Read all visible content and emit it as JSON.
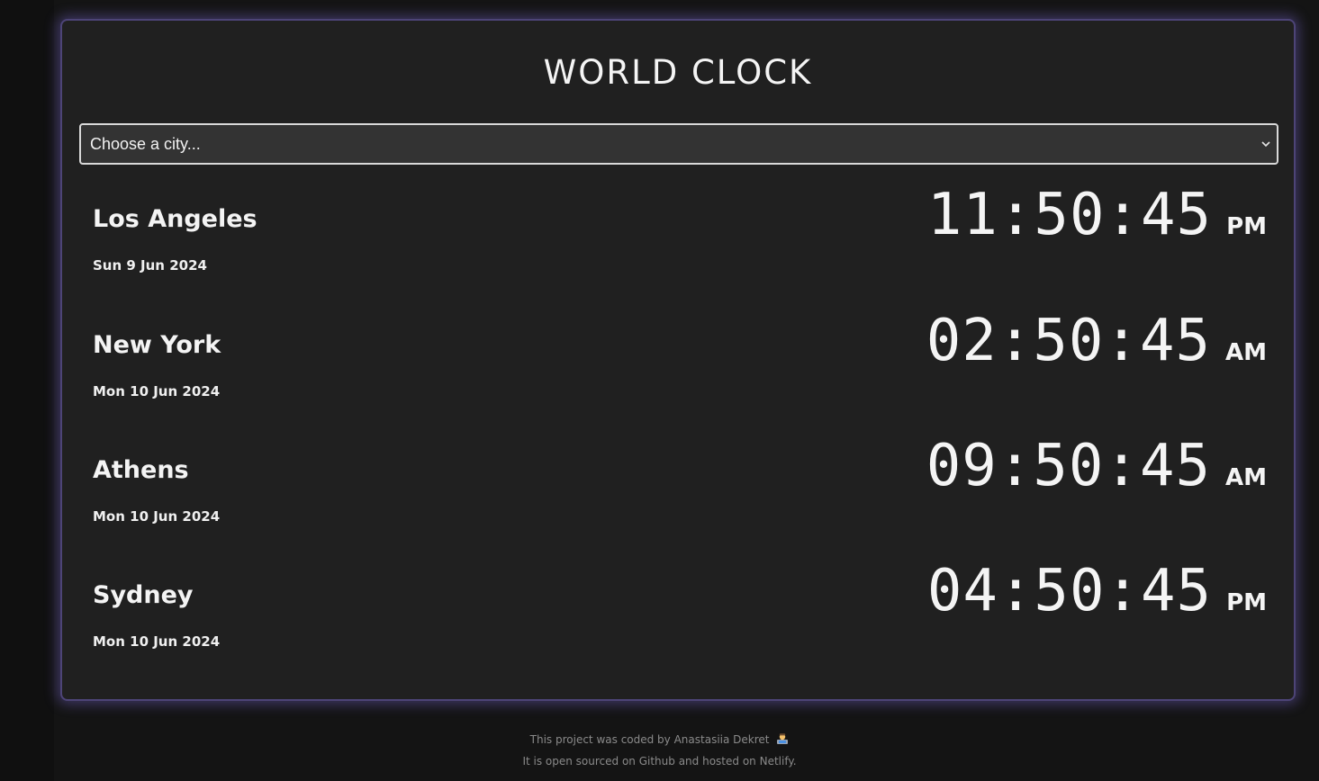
{
  "header": {
    "title": "WORLD CLOCK"
  },
  "city_select": {
    "selected": "Choose a city..."
  },
  "cities": [
    {
      "name": "Los Angeles",
      "date": "Sun 9 Jun 2024",
      "time": "11:50:45",
      "ampm": "PM"
    },
    {
      "name": "New York",
      "date": "Mon 10 Jun 2024",
      "time": "02:50:45",
      "ampm": "AM"
    },
    {
      "name": "Athens",
      "date": "Mon 10 Jun 2024",
      "time": "09:50:45",
      "ampm": "AM"
    },
    {
      "name": "Sydney",
      "date": "Mon 10 Jun 2024",
      "time": "04:50:45",
      "ampm": "PM"
    }
  ],
  "footer": {
    "line1_prefix": "This project was coded by ",
    "author_link": "Anastasiia Dekret",
    "line2_prefix": "It is ",
    "open_source_link": "open sourced on Github",
    "line2_middle": " and ",
    "hosted_link": "hosted on Netlify",
    "line2_suffix": "."
  },
  "colors": {
    "page_background": "#141414",
    "card_background": "#202020",
    "card_glow": "#6e5fbe",
    "text": "#f4f4f4",
    "footer_text": "#8a8a8a"
  }
}
